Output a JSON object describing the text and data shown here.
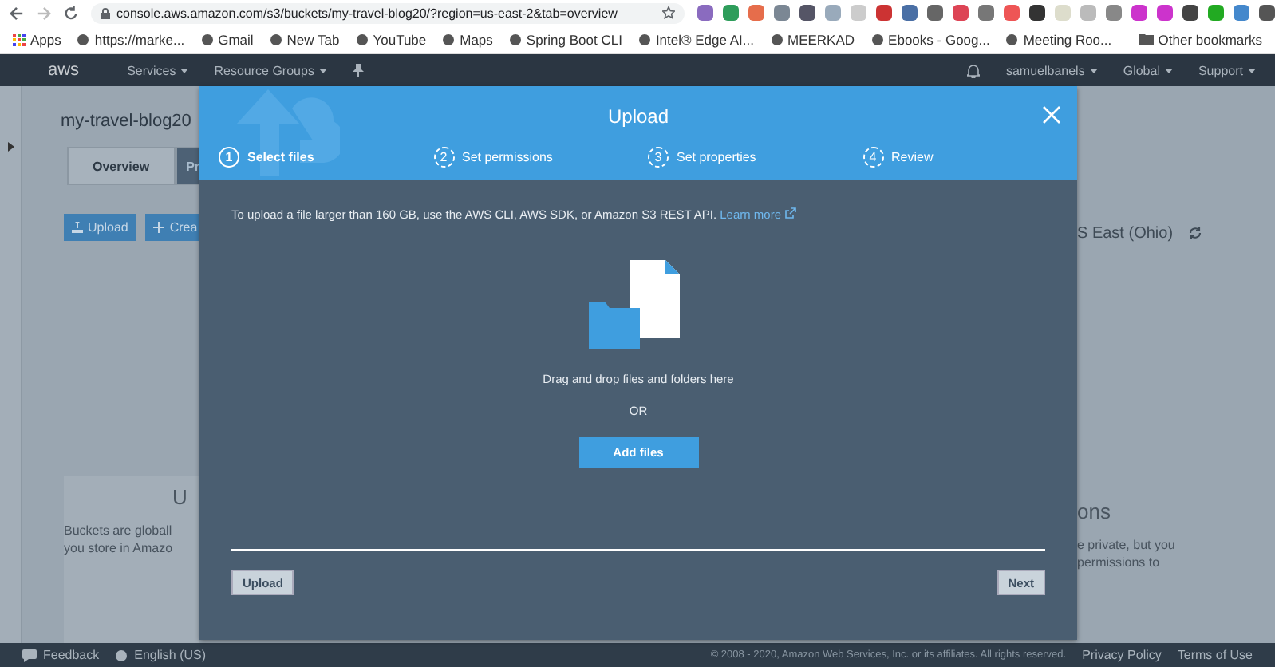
{
  "browser": {
    "url": "console.aws.amazon.com/s3/buckets/my-travel-blog20/?region=us-east-2&tab=overview",
    "bookmarks": [
      "Apps",
      "https://marke...",
      "Gmail",
      "New Tab",
      "YouTube",
      "Maps",
      "Spring Boot CLI",
      "Intel® Edge AI...",
      "MEERKAD",
      "Ebooks - Goog...",
      "Meeting Roo..."
    ],
    "other_bookmarks": "Other bookmarks"
  },
  "nav": {
    "logo": "aws",
    "menus": [
      "Services",
      "Resource Groups"
    ],
    "user": "samuelbanels",
    "region": "Global",
    "support": "Support"
  },
  "background": {
    "bucket_title": "my-travel-blog20",
    "tabs": [
      {
        "label": "Overview",
        "selected": true
      },
      {
        "label": "Pr",
        "selected": false
      }
    ],
    "buttons": [
      "Upload",
      "Crea"
    ],
    "region": "S East (Ohio)",
    "left_heading": "U",
    "left_text": [
      "Buckets are globall",
      "you store in Amazo"
    ],
    "right_heading": "ons",
    "right_text": [
      "e private, but you",
      "permissions to"
    ]
  },
  "modal": {
    "title": "Upload",
    "steps": [
      {
        "number": "1",
        "label": "Select files",
        "selected": true
      },
      {
        "number": "2",
        "label": "Set permissions",
        "selected": false
      },
      {
        "number": "3",
        "label": "Set properties",
        "selected": false
      },
      {
        "number": "4",
        "label": "Review",
        "selected": false
      }
    ],
    "notice": "To upload a file larger than 160 GB, use the AWS CLI, AWS SDK, or Amazon S3 REST API.",
    "learn_more": "Learn more",
    "drop_text": "Drag and drop files and folders here",
    "or": "OR",
    "add_files": "Add files",
    "footer_buttons": [
      {
        "label": "Upload",
        "disabled": true
      },
      {
        "label": "Next",
        "disabled": true
      }
    ]
  },
  "footer": {
    "feedback": "Feedback",
    "language": "English (US)",
    "copyright": "© 2008 - 2020, Amazon Web Services, Inc. or its affiliates. All rights reserved.",
    "privacy": "Privacy Policy",
    "terms": "Terms of Use"
  }
}
